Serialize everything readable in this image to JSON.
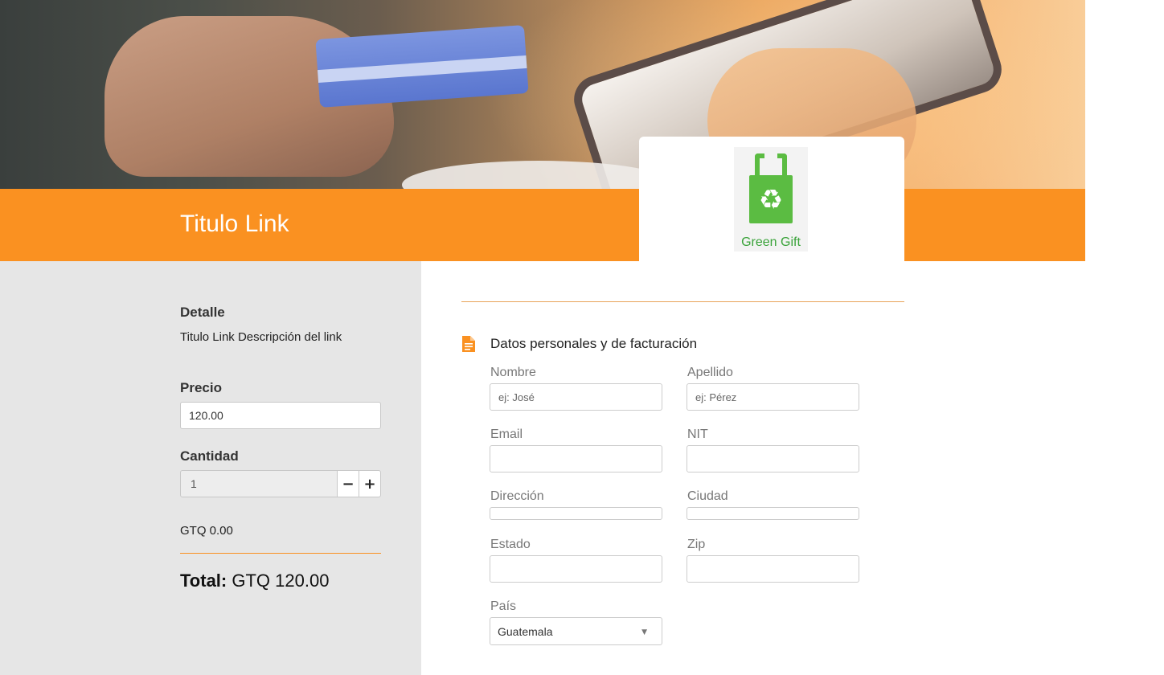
{
  "header": {
    "title": "Titulo Link",
    "logo_text": "Green Gift",
    "accent": "#fa9121",
    "logo_green": "#5bbc42"
  },
  "side": {
    "detalle_label": "Detalle",
    "detalle_text": "Titulo Link Descripción del link",
    "precio_label": "Precio",
    "precio_value": "120.00",
    "cantidad_label": "Cantidad",
    "cantidad_value": "1",
    "minus": "−",
    "plus": "+",
    "subtotal": "GTQ 0.00",
    "total_label": "Total:",
    "total_value": "GTQ 120.00"
  },
  "form": {
    "section_title": "Datos personales y de facturación",
    "section_icon": "document-icon",
    "nombre_label": "Nombre",
    "nombre_placeholder": "ej: José",
    "apellido_label": "Apellido",
    "apellido_placeholder": "ej: Pérez",
    "email_label": "Email",
    "nit_label": "NIT",
    "direccion_label": "Dirección",
    "ciudad_label": "Ciudad",
    "estado_label": "Estado",
    "zip_label": "Zip",
    "pais_label": "País",
    "pais_value": "Guatemala"
  }
}
